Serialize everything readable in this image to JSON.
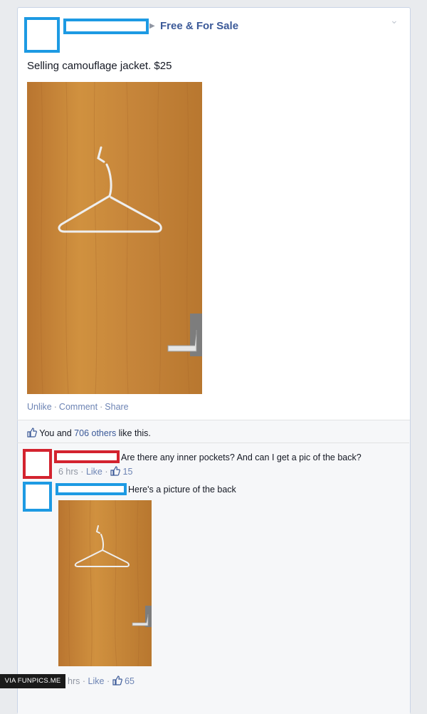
{
  "post": {
    "group_name": "Free & For Sale",
    "text": "Selling camouflage jacket. $25",
    "actions": [
      "Unlike",
      "Comment",
      "Share"
    ],
    "likes_you": "You and",
    "likes_others": "706 others",
    "likes_suffix": "like this."
  },
  "comments": [
    {
      "text": "Are there any inner pockets? And can I get a pic of the back?",
      "time": "6 hrs",
      "like_label": "Like",
      "like_count": "15"
    },
    {
      "text": "Here's a picture of the back",
      "time": "hrs",
      "like_label": "Like",
      "like_count": "65"
    }
  ],
  "watermark": "VIA FUNPICS.ME",
  "colors": {
    "redaction_blue": "#1d9ae3",
    "redaction_red": "#d3232f",
    "link": "#3b5998",
    "door_wood": "#c9873d"
  },
  "icons": [
    "thumbs-up-icon",
    "chevron-down-icon",
    "caret-right-icon"
  ]
}
